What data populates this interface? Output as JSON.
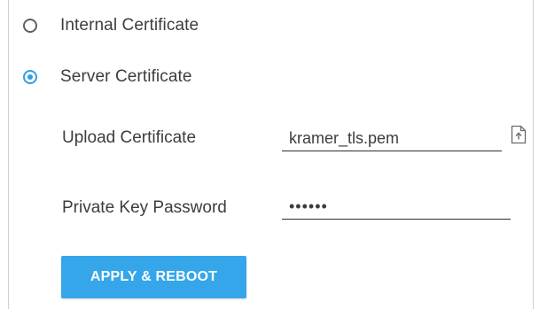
{
  "certificate_options": {
    "internal": {
      "label": "Internal Certificate",
      "selected": false
    },
    "server": {
      "label": "Server Certificate",
      "selected": true
    }
  },
  "upload_certificate": {
    "label": "Upload Certificate",
    "value": "kramer_tls.pem",
    "icon": "file-upload-icon"
  },
  "private_key_password": {
    "label": "Private Key Password",
    "value": "••••••"
  },
  "apply_button": {
    "label": "APPLY & REBOOT"
  },
  "colors": {
    "accent": "#2f9ee5",
    "button_bg": "#35a6ea",
    "text": "#3d3d3d",
    "border": "#cfcfcf"
  }
}
